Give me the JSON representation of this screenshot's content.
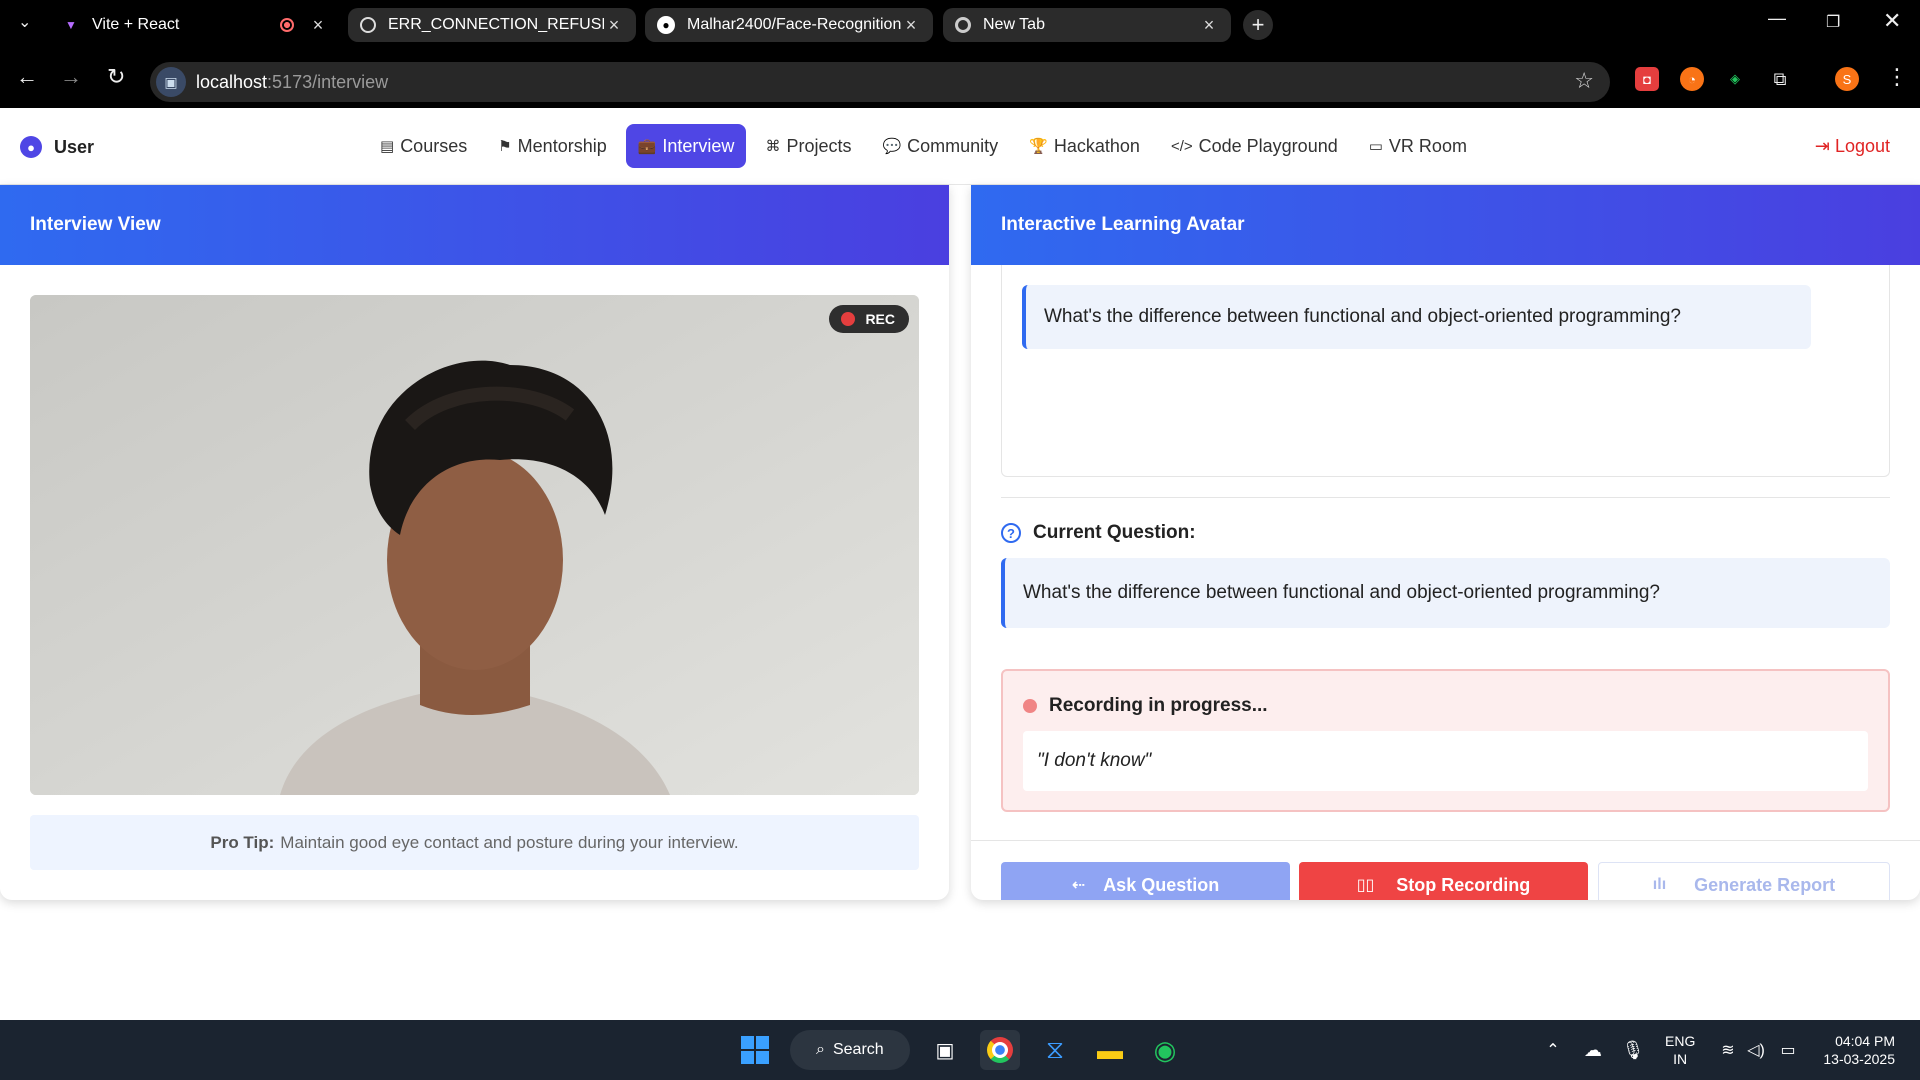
{
  "browser": {
    "tabs": [
      {
        "title": "Vite + React",
        "icon": "vite-icon"
      },
      {
        "title": "ERR_CONNECTION_REFUSED Tr",
        "icon": "openai-icon"
      },
      {
        "title": "Malhar2400/Face-Recognition",
        "icon": "github-icon"
      },
      {
        "title": "New Tab",
        "icon": "chrome-icon"
      }
    ],
    "url_host": "localhost",
    "url_path": ":5173/interview",
    "profile_initial": "S"
  },
  "nav": {
    "user_label": "User",
    "items": [
      {
        "label": "Courses",
        "glyph": "▤"
      },
      {
        "label": "Mentorship",
        "glyph": "⚑"
      },
      {
        "label": "Interview",
        "glyph": "💼"
      },
      {
        "label": "Projects",
        "glyph": "⌘"
      },
      {
        "label": "Community",
        "glyph": "💬"
      },
      {
        "label": "Hackathon",
        "glyph": "🏆"
      },
      {
        "label": "Code Playground",
        "glyph": "</>"
      },
      {
        "label": "VR Room",
        "glyph": "▭"
      }
    ],
    "active_index": 2,
    "logout_label": "Logout"
  },
  "left_panel": {
    "title": "Interview View",
    "rec_label": "REC",
    "tip_label": "Pro Tip:",
    "tip_text": "Maintain good eye contact and posture during your interview."
  },
  "right_panel": {
    "title": "Interactive Learning Avatar",
    "avatar_message": "What's the difference between functional and object-oriented programming?",
    "current_question_label": "Current Question:",
    "current_question": "What's the difference between functional and object-oriented programming?",
    "recording_label": "Recording in progress...",
    "transcript": "\"I don't know\"",
    "buttons": {
      "ask": "Ask Question",
      "stop": "Stop Recording",
      "report": "Generate Report"
    }
  },
  "taskbar": {
    "search_label": "Search",
    "lang_line1": "ENG",
    "lang_line2": "IN",
    "time": "04:04 PM",
    "date": "13-03-2025"
  },
  "colors": {
    "accent": "#4f46e5",
    "header_start": "#2f6af0",
    "header_end": "#4a3fe0",
    "danger": "#ef4444"
  }
}
